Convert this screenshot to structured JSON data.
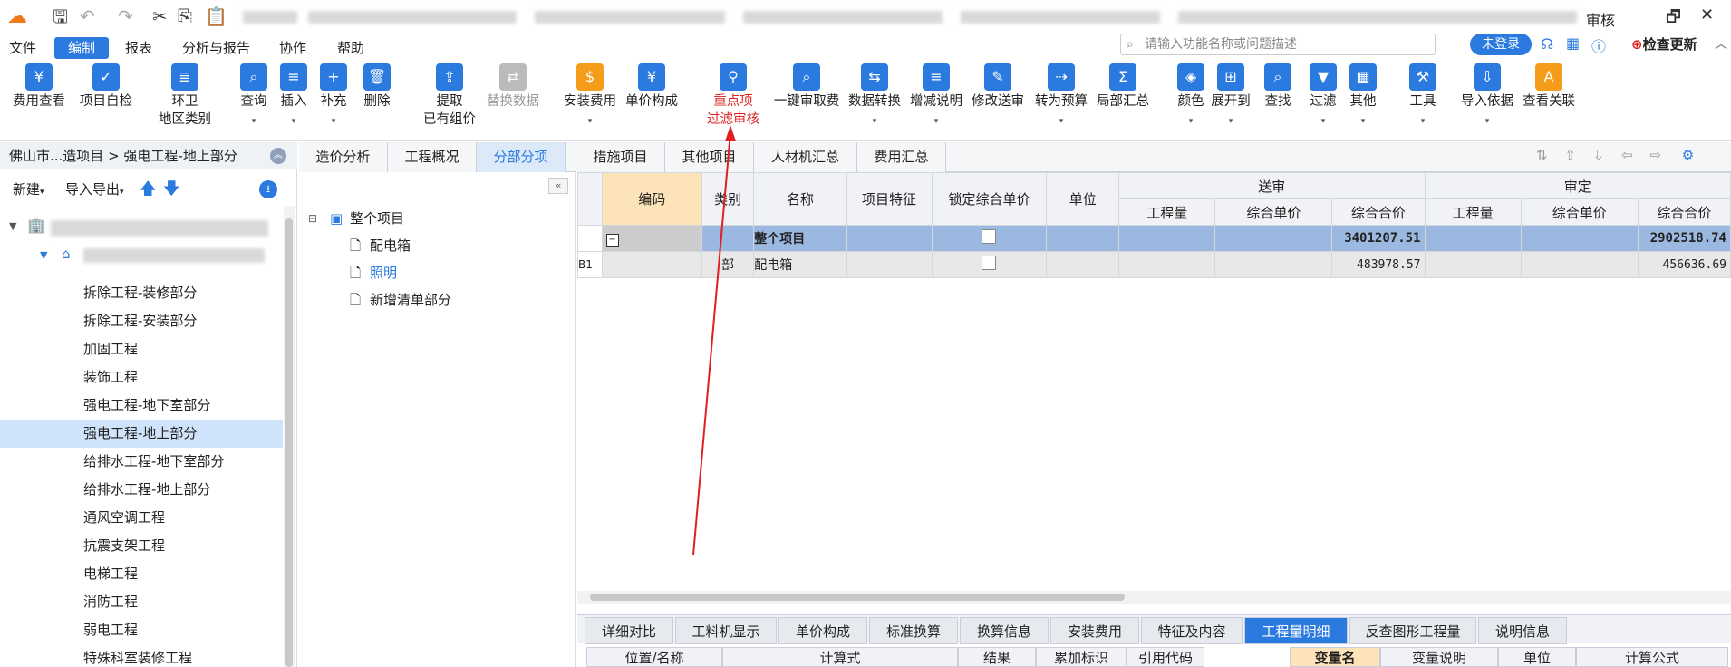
{
  "titlebar": {
    "title_right": "审核"
  },
  "menubar": {
    "items": [
      "文件",
      "编制",
      "报表",
      "分析与报告",
      "协作",
      "帮助"
    ],
    "search_placeholder": "请输入功能名称或问题描述",
    "login": "未登录",
    "update": "检查更新"
  },
  "ribbon": {
    "buttons": [
      "费用查看",
      "项目自检",
      "环卫\n地区类别",
      "查询",
      "插入",
      "补充",
      "删除",
      "提取\n已有组价",
      "替换数据",
      "安装费用",
      "单价构成",
      "重点项\n过滤审核",
      "一键审取费",
      "数据转换",
      "增减说明",
      "修改送审",
      "转为预算",
      "局部汇总",
      "颜色",
      "展开到",
      "查找",
      "过滤",
      "其他",
      "工具",
      "导入依据",
      "查看关联"
    ]
  },
  "left": {
    "breadcrumb": "佛山市...造项目 > 强电工程-地上部分",
    "new": "新建",
    "import_export": "导入导出",
    "items": [
      "拆除工程-装修部分",
      "拆除工程-安装部分",
      "加固工程",
      "装饰工程",
      "强电工程-地下室部分",
      "强电工程-地上部分",
      "给排水工程-地下室部分",
      "给排水工程-地上部分",
      "通风空调工程",
      "抗震支架工程",
      "电梯工程",
      "消防工程",
      "弱电工程",
      "特殊科室装修工程"
    ]
  },
  "tabs": [
    "造价分析",
    "工程概况",
    "分部分项",
    "措施项目",
    "其他项目",
    "人材机汇总",
    "费用汇总"
  ],
  "mid_tree": {
    "root": "整个项目",
    "children": [
      "配电箱",
      "照明",
      "新增清单部分"
    ]
  },
  "grid": {
    "headers": {
      "code": "编码",
      "type": "类别",
      "name": "名称",
      "feature": "项目特征",
      "lock": "锁定综合单价",
      "unit": "单位",
      "submit": "送审",
      "audit": "审定",
      "qty": "工程量",
      "unit_price": "综合单价",
      "total": "综合合价"
    },
    "rows": [
      {
        "idx": "",
        "type": "",
        "name": "整个项目",
        "submit_total": "3401207.51",
        "audit_total": "2902518.74"
      },
      {
        "idx": "B1",
        "type": "部",
        "name": "配电箱",
        "submit_total": "483978.57",
        "audit_total": "456636.69"
      }
    ]
  },
  "bottom_tabs": [
    "详细对比",
    "工料机显示",
    "单价构成",
    "标准换算",
    "换算信息",
    "安装费用",
    "特征及内容",
    "工程量明细",
    "反查图形工程量",
    "说明信息"
  ],
  "bottom_headers": [
    "位置/名称",
    "计算式",
    "结果",
    "累加标识",
    "引用代码",
    "变量名",
    "变量说明",
    "单位",
    "计算公式"
  ],
  "annotation": {
    "line1": "重点项",
    "line2": "过滤审核",
    "color": "#e02020"
  },
  "colors": {
    "accent": "#2b7ae0",
    "selected_row": "#9bb8e0"
  }
}
